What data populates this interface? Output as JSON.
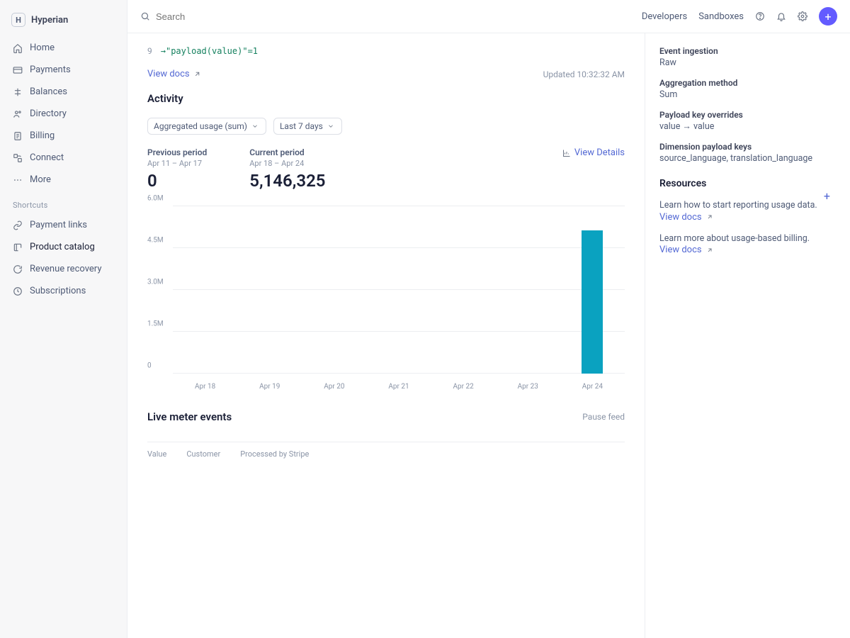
{
  "brand": {
    "initial": "H",
    "name": "Hyperian"
  },
  "search": {
    "placeholder": "Search"
  },
  "nav": {
    "items": [
      {
        "label": "Home"
      },
      {
        "label": "Payments"
      },
      {
        "label": "Balances"
      },
      {
        "label": "Directory"
      },
      {
        "label": "Billing"
      },
      {
        "label": "Connect"
      },
      {
        "label": "More"
      }
    ],
    "shortcuts_label": "Shortcuts",
    "shortcuts": [
      {
        "label": "Payment links"
      },
      {
        "label": "Product catalog",
        "active": true
      },
      {
        "label": "Revenue recovery"
      },
      {
        "label": "Subscriptions"
      }
    ]
  },
  "topbar": {
    "developers": "Developers",
    "sandboxes": "Sandboxes"
  },
  "code": {
    "line_no": "9",
    "snippet": "→\"payload(value)\"=1"
  },
  "viewdocs": "View docs",
  "updated_label": "Updated 10:32:32 AM",
  "activity": {
    "title": "Activity",
    "filter_metric": "Aggregated usage (sum)",
    "filter_period": "Last 7 days",
    "previous": {
      "label": "Previous period",
      "range": "Apr 11 – Apr 17",
      "value": "0"
    },
    "current": {
      "label": "Current period",
      "range": "Apr 18 – Apr 24",
      "value": "5,146,325"
    },
    "view_details": "View Details"
  },
  "chart_data": {
    "type": "bar",
    "categories": [
      "Apr 18",
      "Apr 19",
      "Apr 20",
      "Apr 21",
      "Apr 22",
      "Apr 23",
      "Apr 24"
    ],
    "values": [
      0,
      0,
      0,
      0,
      0,
      0,
      5146325
    ],
    "y_ticks": [
      "0",
      "1.5M",
      "3.0M",
      "4.5M",
      "6.0M"
    ],
    "ylim": [
      0,
      6000000
    ],
    "color": "#0aa2c0"
  },
  "live": {
    "title": "Live meter events",
    "pause": "Pause feed",
    "columns": [
      "Value",
      "Customer",
      "Processed by Stripe"
    ]
  },
  "details": {
    "event_ingestion": {
      "label": "Event ingestion",
      "value": "Raw"
    },
    "aggregation": {
      "label": "Aggregation method",
      "value": "Sum"
    },
    "payload_override": {
      "label": "Payload key overrides",
      "value": "value → value"
    },
    "dimension_keys": {
      "label": "Dimension payload keys",
      "value": "source_language, translation_language"
    }
  },
  "resources": {
    "title": "Resources",
    "r1_text": "Learn how to start reporting usage data.",
    "r1_link": "View docs",
    "r2_text": "Learn more about usage-based billing.",
    "r2_link": "View docs"
  }
}
